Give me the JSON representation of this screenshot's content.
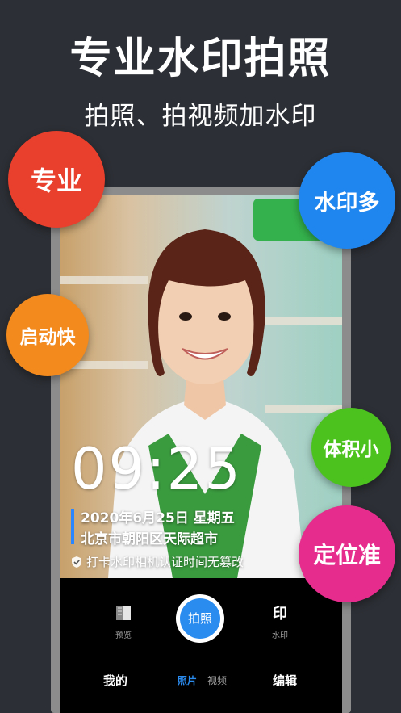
{
  "header": {
    "title": "专业水印拍照",
    "subtitle": "拍照、拍视频加水印"
  },
  "badges": {
    "professional": "专业",
    "many_watermarks": "水印多",
    "fast_start": "启动快",
    "small_size": "体积小",
    "accurate_location": "定位准"
  },
  "watermark": {
    "time": "09:25",
    "date_line": "2020年6月25日 星期五",
    "location_line": "北京市朝阳区天际超市",
    "certification": "打卡水印相机认证时间无篡改"
  },
  "camera_controls": {
    "preview_label": "预览",
    "shutter_label": "拍照",
    "watermark_icon_text": "印",
    "watermark_label": "水印"
  },
  "bottom_nav": {
    "mine": "我的",
    "tab_photo": "照片",
    "tab_video": "视频",
    "edit": "编辑"
  },
  "colors": {
    "background": "#2c2f35",
    "accent_blue": "#2b8cf0",
    "badge_red": "#e8402c",
    "badge_blue": "#1f86f0",
    "badge_orange": "#f28a1e",
    "badge_green": "#4cc21f",
    "badge_magenta": "#e62c8c"
  }
}
